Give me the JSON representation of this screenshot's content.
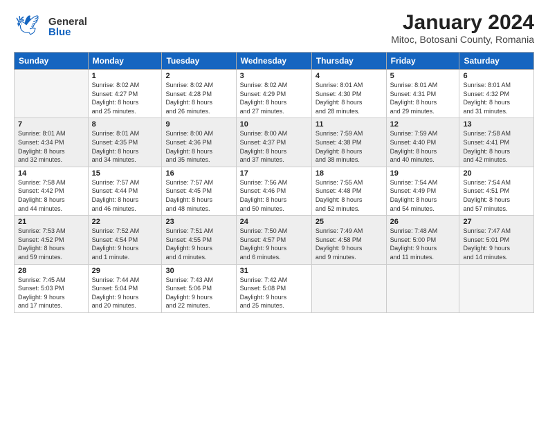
{
  "logo": {
    "general": "General",
    "blue": "Blue"
  },
  "header": {
    "title": "January 2024",
    "subtitle": "Mitoc, Botosani County, Romania"
  },
  "days_of_week": [
    "Sunday",
    "Monday",
    "Tuesday",
    "Wednesday",
    "Thursday",
    "Friday",
    "Saturday"
  ],
  "weeks": [
    [
      {
        "day": "",
        "info": ""
      },
      {
        "day": "1",
        "info": "Sunrise: 8:02 AM\nSunset: 4:27 PM\nDaylight: 8 hours\nand 25 minutes."
      },
      {
        "day": "2",
        "info": "Sunrise: 8:02 AM\nSunset: 4:28 PM\nDaylight: 8 hours\nand 26 minutes."
      },
      {
        "day": "3",
        "info": "Sunrise: 8:02 AM\nSunset: 4:29 PM\nDaylight: 8 hours\nand 27 minutes."
      },
      {
        "day": "4",
        "info": "Sunrise: 8:01 AM\nSunset: 4:30 PM\nDaylight: 8 hours\nand 28 minutes."
      },
      {
        "day": "5",
        "info": "Sunrise: 8:01 AM\nSunset: 4:31 PM\nDaylight: 8 hours\nand 29 minutes."
      },
      {
        "day": "6",
        "info": "Sunrise: 8:01 AM\nSunset: 4:32 PM\nDaylight: 8 hours\nand 31 minutes."
      }
    ],
    [
      {
        "day": "7",
        "info": "Sunrise: 8:01 AM\nSunset: 4:34 PM\nDaylight: 8 hours\nand 32 minutes."
      },
      {
        "day": "8",
        "info": "Sunrise: 8:01 AM\nSunset: 4:35 PM\nDaylight: 8 hours\nand 34 minutes."
      },
      {
        "day": "9",
        "info": "Sunrise: 8:00 AM\nSunset: 4:36 PM\nDaylight: 8 hours\nand 35 minutes."
      },
      {
        "day": "10",
        "info": "Sunrise: 8:00 AM\nSunset: 4:37 PM\nDaylight: 8 hours\nand 37 minutes."
      },
      {
        "day": "11",
        "info": "Sunrise: 7:59 AM\nSunset: 4:38 PM\nDaylight: 8 hours\nand 38 minutes."
      },
      {
        "day": "12",
        "info": "Sunrise: 7:59 AM\nSunset: 4:40 PM\nDaylight: 8 hours\nand 40 minutes."
      },
      {
        "day": "13",
        "info": "Sunrise: 7:58 AM\nSunset: 4:41 PM\nDaylight: 8 hours\nand 42 minutes."
      }
    ],
    [
      {
        "day": "14",
        "info": "Sunrise: 7:58 AM\nSunset: 4:42 PM\nDaylight: 8 hours\nand 44 minutes."
      },
      {
        "day": "15",
        "info": "Sunrise: 7:57 AM\nSunset: 4:44 PM\nDaylight: 8 hours\nand 46 minutes."
      },
      {
        "day": "16",
        "info": "Sunrise: 7:57 AM\nSunset: 4:45 PM\nDaylight: 8 hours\nand 48 minutes."
      },
      {
        "day": "17",
        "info": "Sunrise: 7:56 AM\nSunset: 4:46 PM\nDaylight: 8 hours\nand 50 minutes."
      },
      {
        "day": "18",
        "info": "Sunrise: 7:55 AM\nSunset: 4:48 PM\nDaylight: 8 hours\nand 52 minutes."
      },
      {
        "day": "19",
        "info": "Sunrise: 7:54 AM\nSunset: 4:49 PM\nDaylight: 8 hours\nand 54 minutes."
      },
      {
        "day": "20",
        "info": "Sunrise: 7:54 AM\nSunset: 4:51 PM\nDaylight: 8 hours\nand 57 minutes."
      }
    ],
    [
      {
        "day": "21",
        "info": "Sunrise: 7:53 AM\nSunset: 4:52 PM\nDaylight: 8 hours\nand 59 minutes."
      },
      {
        "day": "22",
        "info": "Sunrise: 7:52 AM\nSunset: 4:54 PM\nDaylight: 9 hours\nand 1 minute."
      },
      {
        "day": "23",
        "info": "Sunrise: 7:51 AM\nSunset: 4:55 PM\nDaylight: 9 hours\nand 4 minutes."
      },
      {
        "day": "24",
        "info": "Sunrise: 7:50 AM\nSunset: 4:57 PM\nDaylight: 9 hours\nand 6 minutes."
      },
      {
        "day": "25",
        "info": "Sunrise: 7:49 AM\nSunset: 4:58 PM\nDaylight: 9 hours\nand 9 minutes."
      },
      {
        "day": "26",
        "info": "Sunrise: 7:48 AM\nSunset: 5:00 PM\nDaylight: 9 hours\nand 11 minutes."
      },
      {
        "day": "27",
        "info": "Sunrise: 7:47 AM\nSunset: 5:01 PM\nDaylight: 9 hours\nand 14 minutes."
      }
    ],
    [
      {
        "day": "28",
        "info": "Sunrise: 7:45 AM\nSunset: 5:03 PM\nDaylight: 9 hours\nand 17 minutes."
      },
      {
        "day": "29",
        "info": "Sunrise: 7:44 AM\nSunset: 5:04 PM\nDaylight: 9 hours\nand 20 minutes."
      },
      {
        "day": "30",
        "info": "Sunrise: 7:43 AM\nSunset: 5:06 PM\nDaylight: 9 hours\nand 22 minutes."
      },
      {
        "day": "31",
        "info": "Sunrise: 7:42 AM\nSunset: 5:08 PM\nDaylight: 9 hours\nand 25 minutes."
      },
      {
        "day": "",
        "info": ""
      },
      {
        "day": "",
        "info": ""
      },
      {
        "day": "",
        "info": ""
      }
    ]
  ]
}
